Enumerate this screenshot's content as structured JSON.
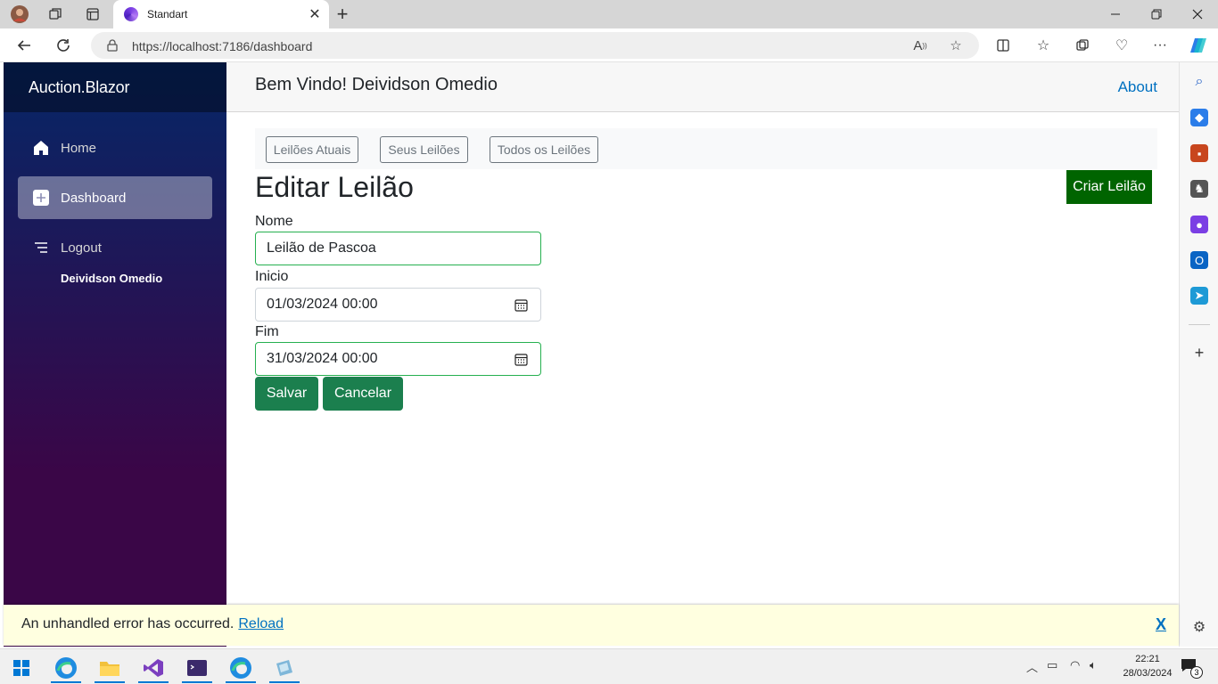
{
  "browser": {
    "tab_title": "Standart",
    "url": "https://localhost:7186/dashboard"
  },
  "app": {
    "brand": "Auction.Blazor",
    "nav": [
      {
        "label": "Home",
        "icon": "home-icon",
        "active": false
      },
      {
        "label": "Dashboard",
        "icon": "plus-square-icon",
        "active": true
      },
      {
        "label": "Logout",
        "icon": "list-icon",
        "active": false
      }
    ],
    "user_name": "Deividson Omedio",
    "welcome": "Bem Vindo! Deividson Omedio",
    "about": "About"
  },
  "filters": {
    "current": "Leilões Atuais",
    "mine": "Seus Leilões",
    "all": "Todos os Leilões"
  },
  "form": {
    "title": "Editar Leilão",
    "create_button": "Criar Leilão",
    "name_label": "Nome",
    "name_value": "Leilão de Pascoa",
    "start_label": "Inicio",
    "start_value": "01/03/2024 00:00",
    "end_label": "Fim",
    "end_value": "31/03/2024 00:00",
    "save": "Salvar",
    "cancel": "Cancelar"
  },
  "error": {
    "message": "An unhandled error has occurred.",
    "reload": "Reload",
    "close": "X"
  },
  "taskbar": {
    "time": "22:21",
    "date": "28/03/2024",
    "notification_count": "3"
  },
  "colors": {
    "sidebar_top": "#052767",
    "sidebar_bottom": "#3a0647",
    "accent_link": "#0071c1",
    "create_button": "#006400",
    "success_button": "#1b7f4e",
    "valid_border": "#26b050",
    "error_bg": "#ffffe0"
  }
}
